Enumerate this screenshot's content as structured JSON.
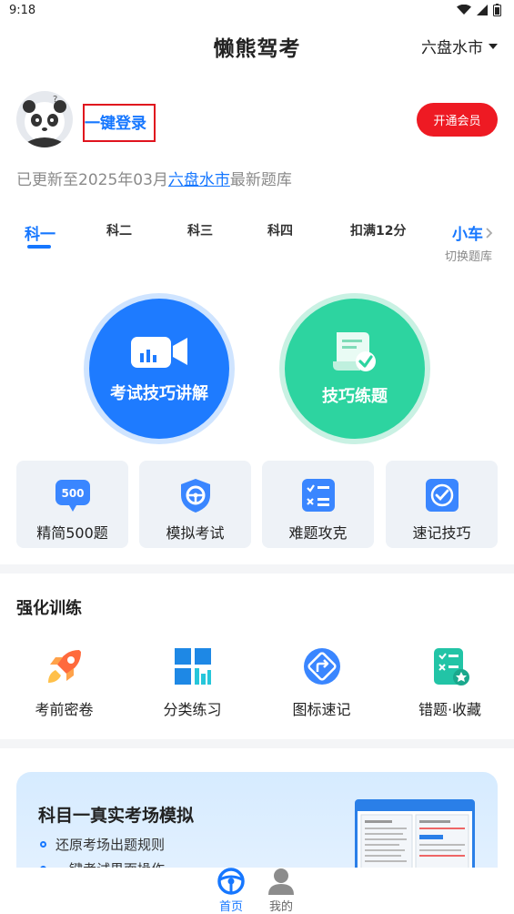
{
  "status_bar": {
    "time": "9:18"
  },
  "header": {
    "title": "懒熊驾考",
    "city": "六盘水市"
  },
  "profile": {
    "login_label": "一键登录",
    "vip_button": "开通会员",
    "update_prefix": "已更新至2025年03月",
    "update_city": "六盘水市",
    "update_suffix": "最新题库"
  },
  "subject_tabs": [
    {
      "label": "科一",
      "active": true
    },
    {
      "label": "科二"
    },
    {
      "label": "科三"
    },
    {
      "label": "科四"
    },
    {
      "label": "扣满12分"
    }
  ],
  "vehicle": {
    "label": "小车",
    "switch_label": "切换题库"
  },
  "main_actions": [
    {
      "label": "考试技巧讲解",
      "color": "#1e7bff"
    },
    {
      "label": "技巧练题",
      "color": "#2dd4a0"
    }
  ],
  "quick_cards": [
    {
      "label": "精简500题",
      "icon": "500-badge-icon",
      "badge": "500"
    },
    {
      "label": "模拟考试",
      "icon": "steering-shield-icon"
    },
    {
      "label": "难题攻克",
      "icon": "checklist-icon"
    },
    {
      "label": "速记技巧",
      "icon": "check-circle-icon"
    }
  ],
  "training": {
    "title": "强化训练",
    "items": [
      {
        "label": "考前密卷",
        "icon": "rocket-icon"
      },
      {
        "label": "分类练习",
        "icon": "grid-icon"
      },
      {
        "label": "图标速记",
        "icon": "road-sign-icon"
      },
      {
        "label": "错题·收藏",
        "icon": "wrong-answers-icon"
      }
    ]
  },
  "banner": {
    "title": "科目一真实考场模拟",
    "bullets": [
      "还原考场出题规则",
      "一键考试界面操作"
    ]
  },
  "bottom_nav": [
    {
      "label": "首页",
      "active": true,
      "icon": "steering-wheel-icon"
    },
    {
      "label": "我的",
      "active": false,
      "icon": "person-icon"
    }
  ],
  "colors": {
    "accent": "#1677ff",
    "vip": "#ee1a23",
    "tip_green": "#2dd4a0"
  }
}
